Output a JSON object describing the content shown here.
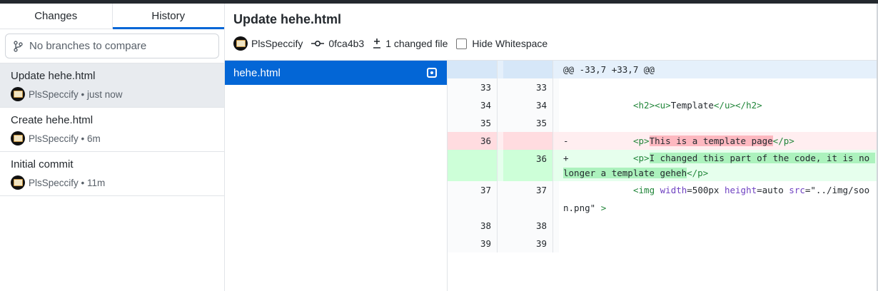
{
  "sidebar": {
    "tabs": [
      {
        "label": "Changes"
      },
      {
        "label": "History"
      }
    ],
    "branch_placeholder": "No branches to compare",
    "commits": [
      {
        "title": "Update hehe.html",
        "author": "PlsSpeccify",
        "time": "just now"
      },
      {
        "title": "Create hehe.html",
        "author": "PlsSpeccify",
        "time": "6m"
      },
      {
        "title": "Initial commit",
        "author": "PlsSpeccify",
        "time": "11m"
      }
    ]
  },
  "header": {
    "title": "Update hehe.html",
    "author": "PlsSpeccify",
    "sha": "0fca4b3",
    "changed_files": "1 changed file",
    "hide_whitespace": "Hide Whitespace"
  },
  "files": [
    {
      "name": "hehe.html"
    }
  ],
  "diff": {
    "hunk": "@@ -33,7 +33,7 @@",
    "rows": [
      {
        "old": "33",
        "new": "33"
      },
      {
        "old": "34",
        "new": "34",
        "t1": "<h2>",
        "t2": "<u>",
        "text": "Template",
        "t3": "</u>",
        "t4": "</h2>"
      },
      {
        "old": "35",
        "new": "35"
      },
      {
        "old": "36",
        "sign": "-",
        "t1": "<p>",
        "changed": "This is a template page",
        "t2": "</p>"
      },
      {
        "new": "36",
        "sign": "+",
        "t1": "<p>",
        "changed": "I changed this part of the code, it is no longer a template geheh",
        "t2": "</p>"
      },
      {
        "old": "37",
        "new": "37",
        "t1": "<img",
        "a1": "width",
        "v1": "=500px",
        "a2": "height",
        "v2": "=auto",
        "a3": "src",
        "v3": "=\"../img/soon.png\"",
        "t2": ">"
      },
      {
        "old": "38",
        "new": "38"
      },
      {
        "old": "39",
        "new": "39"
      }
    ]
  },
  "colors": {
    "accent": "#0366d6",
    "deleted": "#ffeef0",
    "added": "#e6ffed"
  }
}
